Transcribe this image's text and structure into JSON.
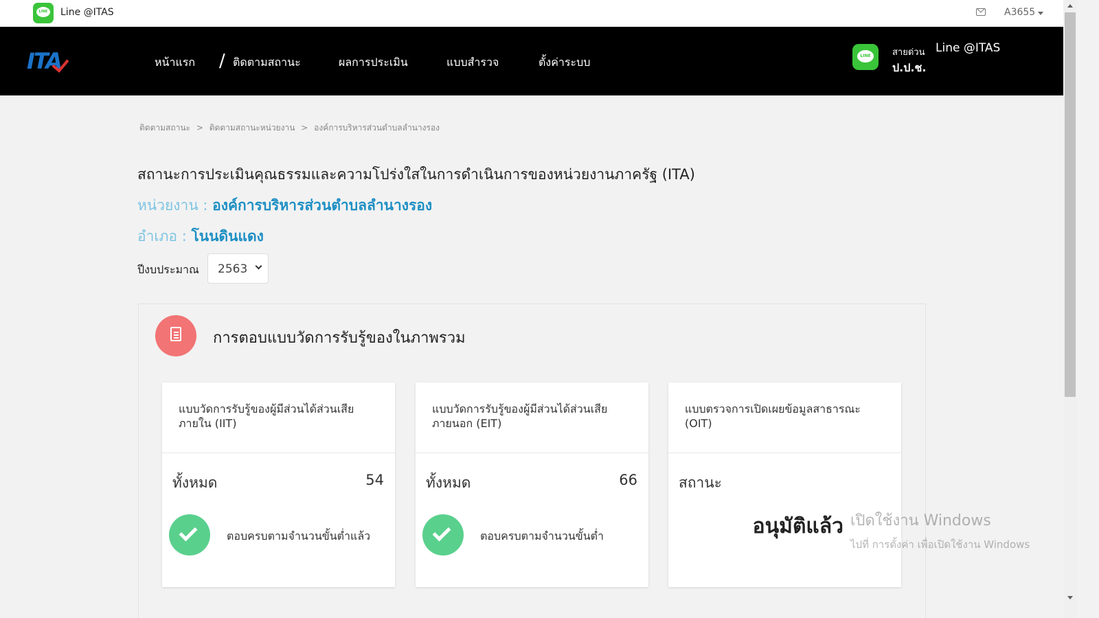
{
  "topbar": {
    "brand": "Line @ITAS",
    "user": "A3655",
    "line_logo_text": "LINE"
  },
  "navbar": {
    "logo_text": "ITA",
    "items": [
      {
        "label": "หน้าแรก"
      },
      {
        "label": "ติดตามสถานะ"
      },
      {
        "label": "ผลการประเมิน"
      },
      {
        "label": "แบบสำรวจ"
      },
      {
        "label": "ตั้งค่าระบบ"
      }
    ],
    "hotline_label": "สายด่วน",
    "hotline_name": "Line @ITAS",
    "hotline_org": "ป.ป.ช."
  },
  "breadcrumb": [
    "ติดตามสถานะ",
    "ติดตามสถานะหน่วยงาน",
    "องค์การบริหารส่วนตำบลลำนางรอง"
  ],
  "breadcrumb_sep": ">",
  "page": {
    "title": "สถานะการประเมินคุณธรรมและความโปร่งใสในการดำเนินการของหน่วยงานภาครัฐ (ITA)",
    "agency_label": "หน่วยงาน :",
    "agency_value": "องค์การบริหารส่วนตำบลลำนางรอง",
    "district_label": "อำเภอ :",
    "district_value": "โนนดินแดง",
    "year_label": "ปีงบประมาณ",
    "year_value": "2563"
  },
  "panel": {
    "title": "การตอบแบบวัดการรับรู้ของในภาพรวม",
    "cards": [
      {
        "title": "แบบวัดการรับรู้ของผู้มีส่วนได้ส่วนเสียภายใน (IIT)",
        "total_label": "ทั้งหมด",
        "total_value": "54",
        "status_text": "ตอบครบตามจำนวนขั้นต่ำแล้ว"
      },
      {
        "title": "แบบวัดการรับรู้ของผู้มีส่วนได้ส่วนเสียภายนอก (EIT)",
        "total_label": "ทั้งหมด",
        "total_value": "66",
        "status_text": "ตอบครบตามจำนวนขั้นต่ำ"
      },
      {
        "title": "แบบตรวจการเปิดเผยข้อมูลสาธารณะ (OIT)",
        "status_label": "สถานะ",
        "status_value": "อนุมัติแล้ว"
      }
    ]
  },
  "watermark": {
    "line1": "เปิดใช้งาน Windows",
    "line2": "ไปที่ การตั้งค่า เพื่อเปิดใช้งาน Windows"
  },
  "colors": {
    "navbar_bg": "#000000",
    "line_green": "#3ac43a",
    "accent_blue": "#1d8fc4",
    "label_blue": "#7dc4e2",
    "doc_icon_bg": "#f27474",
    "check_green": "#5ad08d"
  }
}
